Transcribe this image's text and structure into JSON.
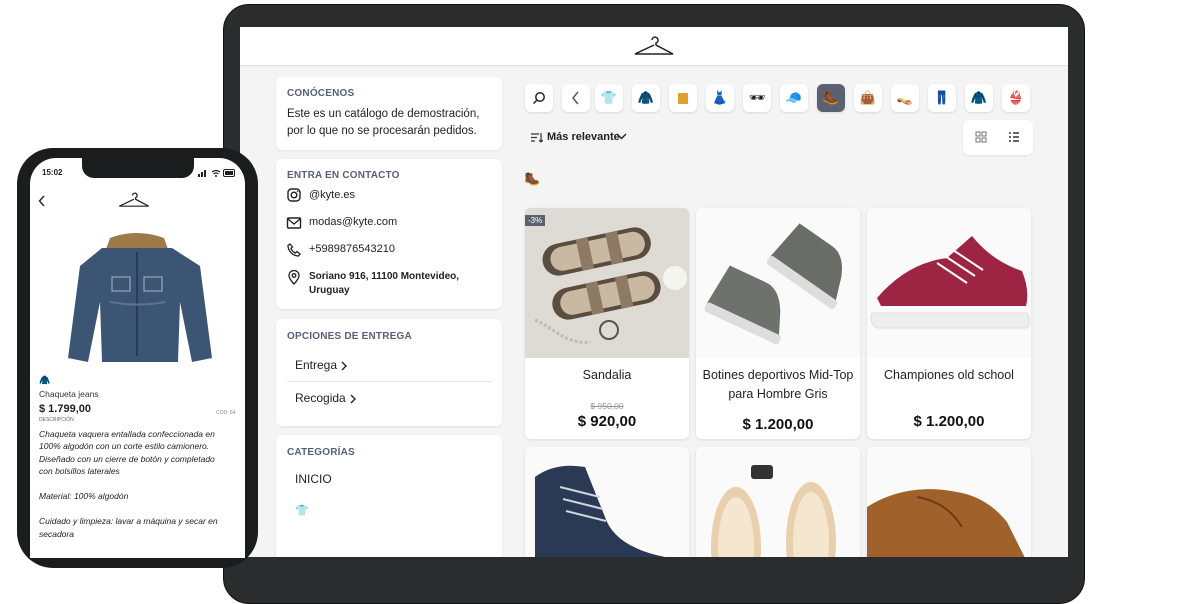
{
  "store": {
    "about": {
      "title": "CONÓCENOS",
      "line1": "Este es un catálogo de demostración,",
      "line2": "por lo que no se procesarán pedidos."
    },
    "contact": {
      "title": "ENTRA EN CONTACTO",
      "instagram": "@kyte.es",
      "email": "modas@kyte.com",
      "phone": "+5989876543210",
      "address_line1": "Soriano 916, 11100 Montevideo,",
      "address_line2": "Uruguay"
    },
    "delivery": {
      "title": "OPCIONES DE ENTREGA",
      "option1": "Entrega",
      "option2": "Recogida"
    },
    "categories": {
      "title": "CATEGORÍAS",
      "first": "INICIO"
    },
    "sort": {
      "label": "Más relevante"
    },
    "category_icons": [
      "search-icon",
      "back-icon",
      "shirt-icon",
      "jacket-icon",
      "shorts-icon",
      "dress-icon",
      "sunglasses-icon",
      "cap-icon",
      "boot-icon",
      "handbag-icon",
      "heels-icon",
      "jeans-icon",
      "coat-icon",
      "bikini-icon"
    ],
    "products": [
      {
        "name": "Sandalia",
        "old_price": "$ 950,00",
        "price": "$ 920,00",
        "badge": "-3%"
      },
      {
        "name_line1": "Botines deportivos Mid-Top",
        "name_line2": "para Hombre Gris",
        "price": "$ 1.200,00"
      },
      {
        "name": "Championes old school",
        "price": "$ 1.200,00"
      }
    ]
  },
  "phone": {
    "time": "15:02",
    "product_name": "Chaqueta jeans",
    "price": "$ 1.799,00",
    "code": "COD: 54",
    "desc_label": "DESCRIPCIÓN",
    "desc_lines": [
      "Chaqueta vaquera entallada confeccionada en",
      "100% algodón con un corte estilo camionero.",
      "Diseñado con un cierre de botón y completado",
      "con bolsillos laterales"
    ],
    "material": "Material: 100% algodón",
    "care_line1": "Cuidado y limpieza: lavar a máquina y secar en",
    "care_line2": "secadora"
  },
  "colors": {
    "accent": "#56607a",
    "selected_category": "#5b6170"
  }
}
